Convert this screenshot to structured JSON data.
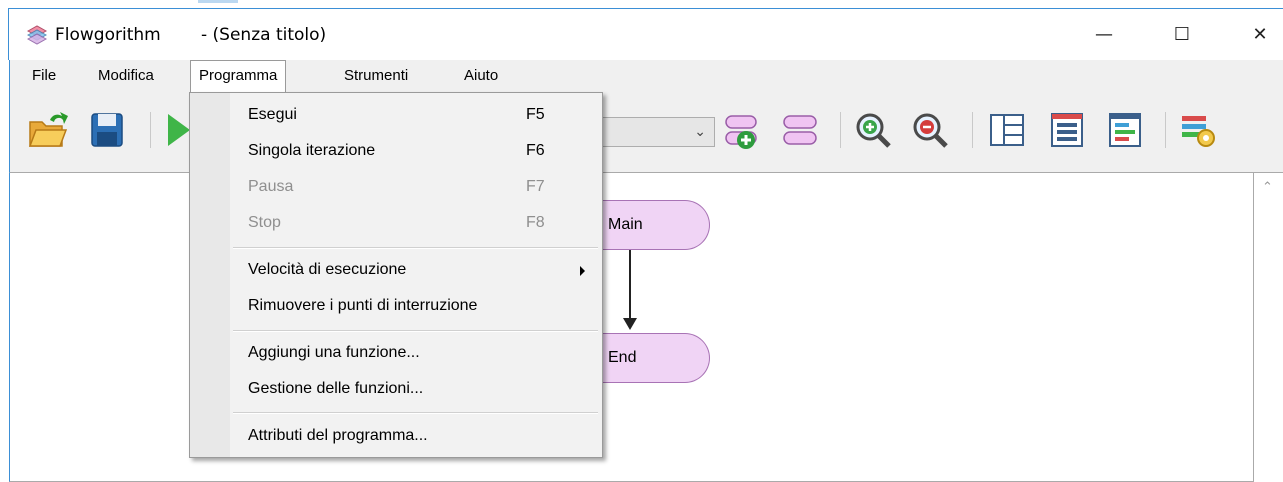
{
  "window": {
    "app_name": "Flowgorithm",
    "document_title": "- (Senza titolo)",
    "minimize_glyph": "—",
    "maximize_glyph": "☐",
    "close_glyph": "✕"
  },
  "menubar": {
    "items": [
      {
        "label": "File"
      },
      {
        "label": "Modifica"
      },
      {
        "label": "Programma"
      },
      {
        "label": "Strumenti"
      },
      {
        "label": "Aiuto"
      }
    ],
    "active": "Programma"
  },
  "toolbar": {
    "icons": [
      "open-folder-icon",
      "save-icon",
      "run-icon",
      "add-function-icon",
      "functions-icon",
      "zoom-in-icon",
      "zoom-out-icon",
      "layout-icon",
      "variables-icon",
      "console-icon",
      "settings-icon"
    ],
    "combo_value": ""
  },
  "programma_menu": {
    "items": [
      {
        "label": "Esegui",
        "shortcut": "F5",
        "enabled": true
      },
      {
        "label": "Singola iterazione",
        "shortcut": "F6",
        "enabled": true
      },
      {
        "label": "Pausa",
        "shortcut": "F7",
        "enabled": false
      },
      {
        "label": "Stop",
        "shortcut": "F8",
        "enabled": false
      },
      {
        "label": "Velocità di esecuzione",
        "shortcut": "",
        "enabled": true,
        "submenu": true
      },
      {
        "label": "Rimuovere i punti di interruzione",
        "shortcut": "",
        "enabled": true
      },
      {
        "label": "Aggiungi una funzione...",
        "shortcut": "",
        "enabled": true
      },
      {
        "label": "Gestione delle funzioni...",
        "shortcut": "",
        "enabled": true
      },
      {
        "label": "Attributi del programma...",
        "shortcut": "",
        "enabled": true
      }
    ]
  },
  "flowchart": {
    "start_node": "Main",
    "end_node": "End"
  },
  "colors": {
    "node_fill": "#f0d4f5",
    "node_border": "#a873b5",
    "accent_blue": "#3b8fd6"
  }
}
